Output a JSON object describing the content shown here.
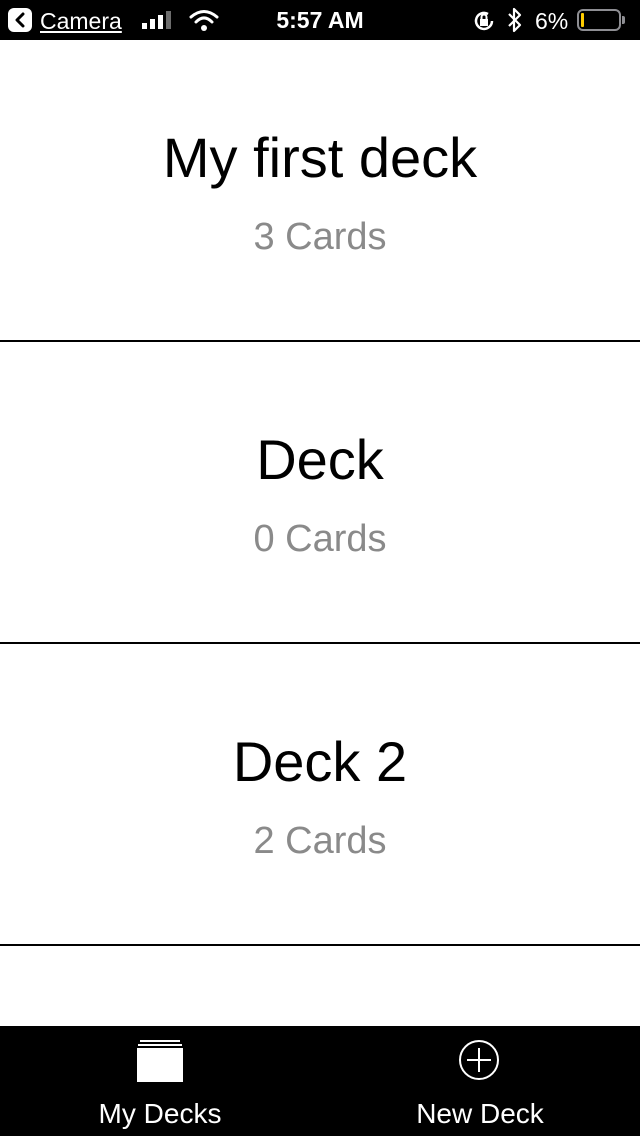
{
  "status_bar": {
    "back_label": "Camera",
    "time": "5:57 AM",
    "battery_percent": "6%",
    "battery_level": 0.06,
    "icons": [
      "back-arrow-icon",
      "cellular-signal-icon",
      "wifi-icon",
      "rotation-lock-icon",
      "bluetooth-icon",
      "battery-icon"
    ],
    "battery_color": "#ffcc00"
  },
  "decks": [
    {
      "title": "My first deck",
      "count": "3 Cards"
    },
    {
      "title": "Deck",
      "count": "0 Cards"
    },
    {
      "title": "Deck 2",
      "count": "2 Cards"
    }
  ],
  "tab_bar": {
    "tabs": [
      {
        "label": "My Decks",
        "icon": "deck-stack-icon"
      },
      {
        "label": "New Deck",
        "icon": "add-circle-icon"
      }
    ]
  },
  "colors": {
    "background": "#ffffff",
    "bars": "#000000",
    "subtitle": "#8a8a8a"
  }
}
